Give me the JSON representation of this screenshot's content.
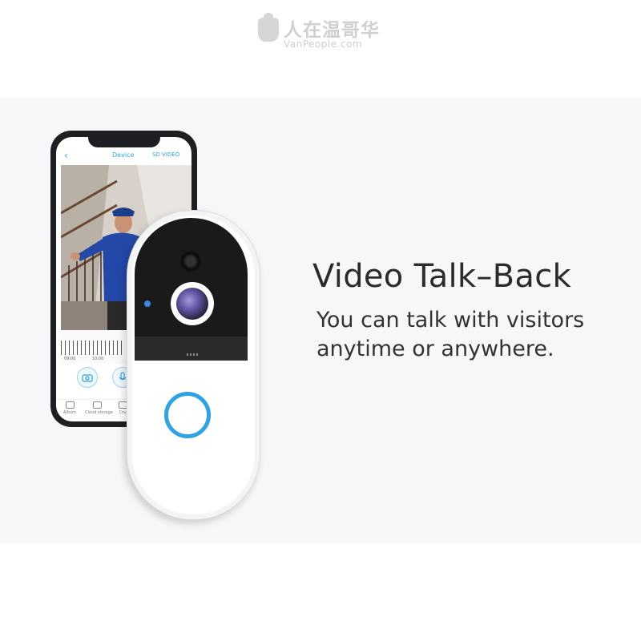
{
  "watermark": {
    "title": "人在温哥华",
    "subtitle": "VanPeople.com"
  },
  "feature": {
    "heading": "Video Talk–Back",
    "description_line1": "You can talk with visitors",
    "description_line2": "anytime or anywhere."
  },
  "phone_app": {
    "title": "Device",
    "right_label": "SD VIDEO",
    "timeline_labels": [
      "09:00",
      "10:00"
    ],
    "tabs": [
      "Album",
      "Cloud storage",
      "Cru"
    ]
  },
  "colors": {
    "accent": "#2ea3e3",
    "background_band": "#f6f7f9",
    "led": "#3a86e8"
  }
}
